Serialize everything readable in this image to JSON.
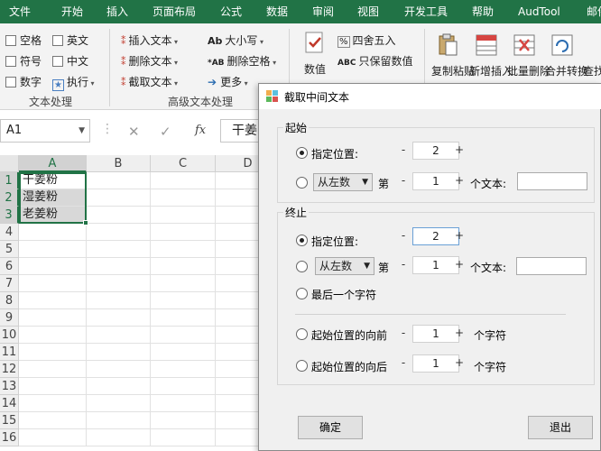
{
  "ribbon": {
    "tabs": [
      "文件",
      "开始",
      "插入",
      "页面布局",
      "公式",
      "数据",
      "审阅",
      "视图",
      "开发工具",
      "帮助",
      "AudTool",
      "邮件"
    ],
    "text_group": {
      "items": [
        "空格",
        "英文",
        "符号",
        "中文",
        "数字",
        "执行"
      ],
      "label": "文本处理"
    },
    "advanced_group": {
      "items": [
        "插入文本",
        "删除文本",
        "截取文本",
        "大小写",
        "删除空格",
        "更多"
      ],
      "label": "高级文本处理"
    },
    "number_group": {
      "big_label": "数值",
      "items": [
        "四舍五入",
        "只保留数值"
      ]
    },
    "right_buttons": [
      "复制粘贴",
      "新增插入",
      "批量删除",
      "合并转换",
      "查找定位"
    ]
  },
  "formula_bar": {
    "name_box": "A1",
    "fx": "fx",
    "content": "干姜"
  },
  "sheet": {
    "columns": [
      "A",
      "B",
      "C",
      "D"
    ],
    "rows": [
      "1",
      "2",
      "3",
      "4",
      "5",
      "6",
      "7",
      "8",
      "9",
      "10",
      "11",
      "12",
      "13",
      "14",
      "15",
      "16"
    ],
    "cells": [
      "干姜粉",
      "湿姜粉",
      "老姜粉"
    ]
  },
  "dialog": {
    "title": "截取中间文本",
    "start": {
      "title": "起始",
      "opt_position": "指定位置:",
      "position_value": "2",
      "combo": "从左数",
      "di": "第",
      "nth_value": "1",
      "ge_text": "个文本:"
    },
    "end": {
      "title": "终止",
      "opt_position": "指定位置:",
      "position_value": "2",
      "combo": "从左数",
      "di": "第",
      "nth_value": "1",
      "ge_text": "个文本:",
      "opt_last": "最后一个字符",
      "opt_before": "起始位置的向前",
      "before_value": "1",
      "opt_after": "起始位置的向后",
      "after_value": "1",
      "ge_char": "个字符"
    },
    "ok": "确定",
    "exit": "退出"
  }
}
